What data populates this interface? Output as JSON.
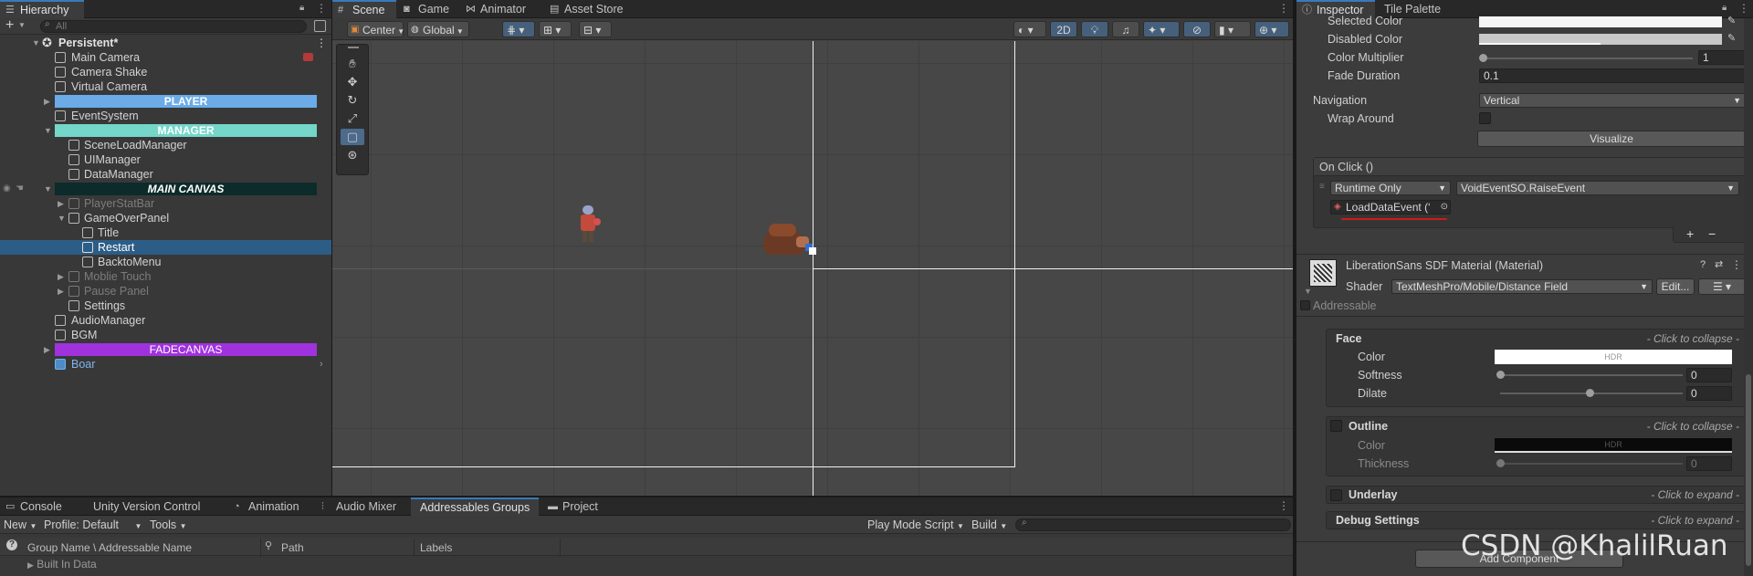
{
  "hierarchy": {
    "tab": "Hierarchy",
    "search_placeholder": "All",
    "add_label": "+",
    "items": [
      {
        "label": "Persistent*",
        "kind": "scene"
      },
      {
        "label": "Main Camera"
      },
      {
        "label": "Camera Shake"
      },
      {
        "label": "Virtual Camera"
      },
      {
        "label": "PLAYER",
        "band": "#6aabe8",
        "band_text": "#ffffff"
      },
      {
        "label": "EventSystem"
      },
      {
        "label": "MANAGER",
        "band": "#74d6c9",
        "band_text": "#ffffff"
      },
      {
        "label": "SceneLoadManager"
      },
      {
        "label": "UIManager"
      },
      {
        "label": "DataManager"
      },
      {
        "label": "MAIN CANVAS",
        "band": "#0c2b2a",
        "band_text": "#ffffff"
      },
      {
        "label": "PlayerStatBar",
        "dim": true
      },
      {
        "label": "GameOverPanel"
      },
      {
        "label": "Title"
      },
      {
        "label": "Restart",
        "selected": true
      },
      {
        "label": "BacktoMenu"
      },
      {
        "label": "Moblie Touch",
        "dim": true
      },
      {
        "label": "Pause Panel",
        "dim": true
      },
      {
        "label": "Settings"
      },
      {
        "label": "AudioManager"
      },
      {
        "label": "BGM"
      },
      {
        "label": "FADECANVAS",
        "band": "#a032dd",
        "band_text": "#ffffff"
      },
      {
        "label": "Boar",
        "prefab": true
      }
    ]
  },
  "scene": {
    "tabs": [
      "Scene",
      "Game",
      "Animator",
      "Asset Store"
    ],
    "pivot": "Center",
    "space": "Global",
    "mode_2d": "2D"
  },
  "bottom": {
    "tabs": [
      "Console",
      "Unity Version Control",
      "Animation",
      "Audio Mixer",
      "Addressables Groups",
      "Project"
    ],
    "new_label": "New",
    "profile_label": "Profile: Default",
    "tools_label": "Tools",
    "play_mode_label": "Play Mode Script",
    "build_label": "Build",
    "columns": [
      "Group Name \\ Addressable Name",
      "Path",
      "Labels"
    ],
    "row": "Built In Data"
  },
  "inspector": {
    "tabs": [
      "Inspector",
      "Tile Palette"
    ],
    "selected_color_label": "Selected Color",
    "disabled_color_label": "Disabled Color",
    "color_multiplier_label": "Color Multiplier",
    "color_multiplier_value": "1",
    "fade_duration_label": "Fade Duration",
    "fade_duration_value": "0.1",
    "navigation_label": "Navigation",
    "navigation_value": "Vertical",
    "wrap_around_label": "Wrap Around",
    "visualize_label": "Visualize",
    "onclick_label": "On Click ()",
    "runtime_value": "Runtime Only",
    "function_value": "VoidEventSO.RaiseEvent",
    "object_value": "LoadDataEvent (‘",
    "plus": "+",
    "minus": "−",
    "material_title": "LiberationSans SDF Material (Material)",
    "shader_label": "Shader",
    "shader_value": "TextMeshPro/Mobile/Distance Field",
    "edit_label": "Edit...",
    "addressable_label": "Addressable",
    "face_label": "Face",
    "face_hint": "- Click to collapse -",
    "color_label": "Color",
    "hdr": "HDR",
    "softness_label": "Softness",
    "softness_value": "0",
    "dilate_label": "Dilate",
    "dilate_value": "0",
    "outline_label": "Outline",
    "outline_hint": "- Click to collapse -",
    "outline_color_label": "Color",
    "thickness_label": "Thickness",
    "thickness_value": "0",
    "underlay_label": "Underlay",
    "underlay_hint": "- Click to expand -",
    "debug_label": "Debug Settings",
    "debug_hint": "- Click to expand -",
    "add_component": "Add Component"
  },
  "watermark": "CSDN @KhalilRuan"
}
